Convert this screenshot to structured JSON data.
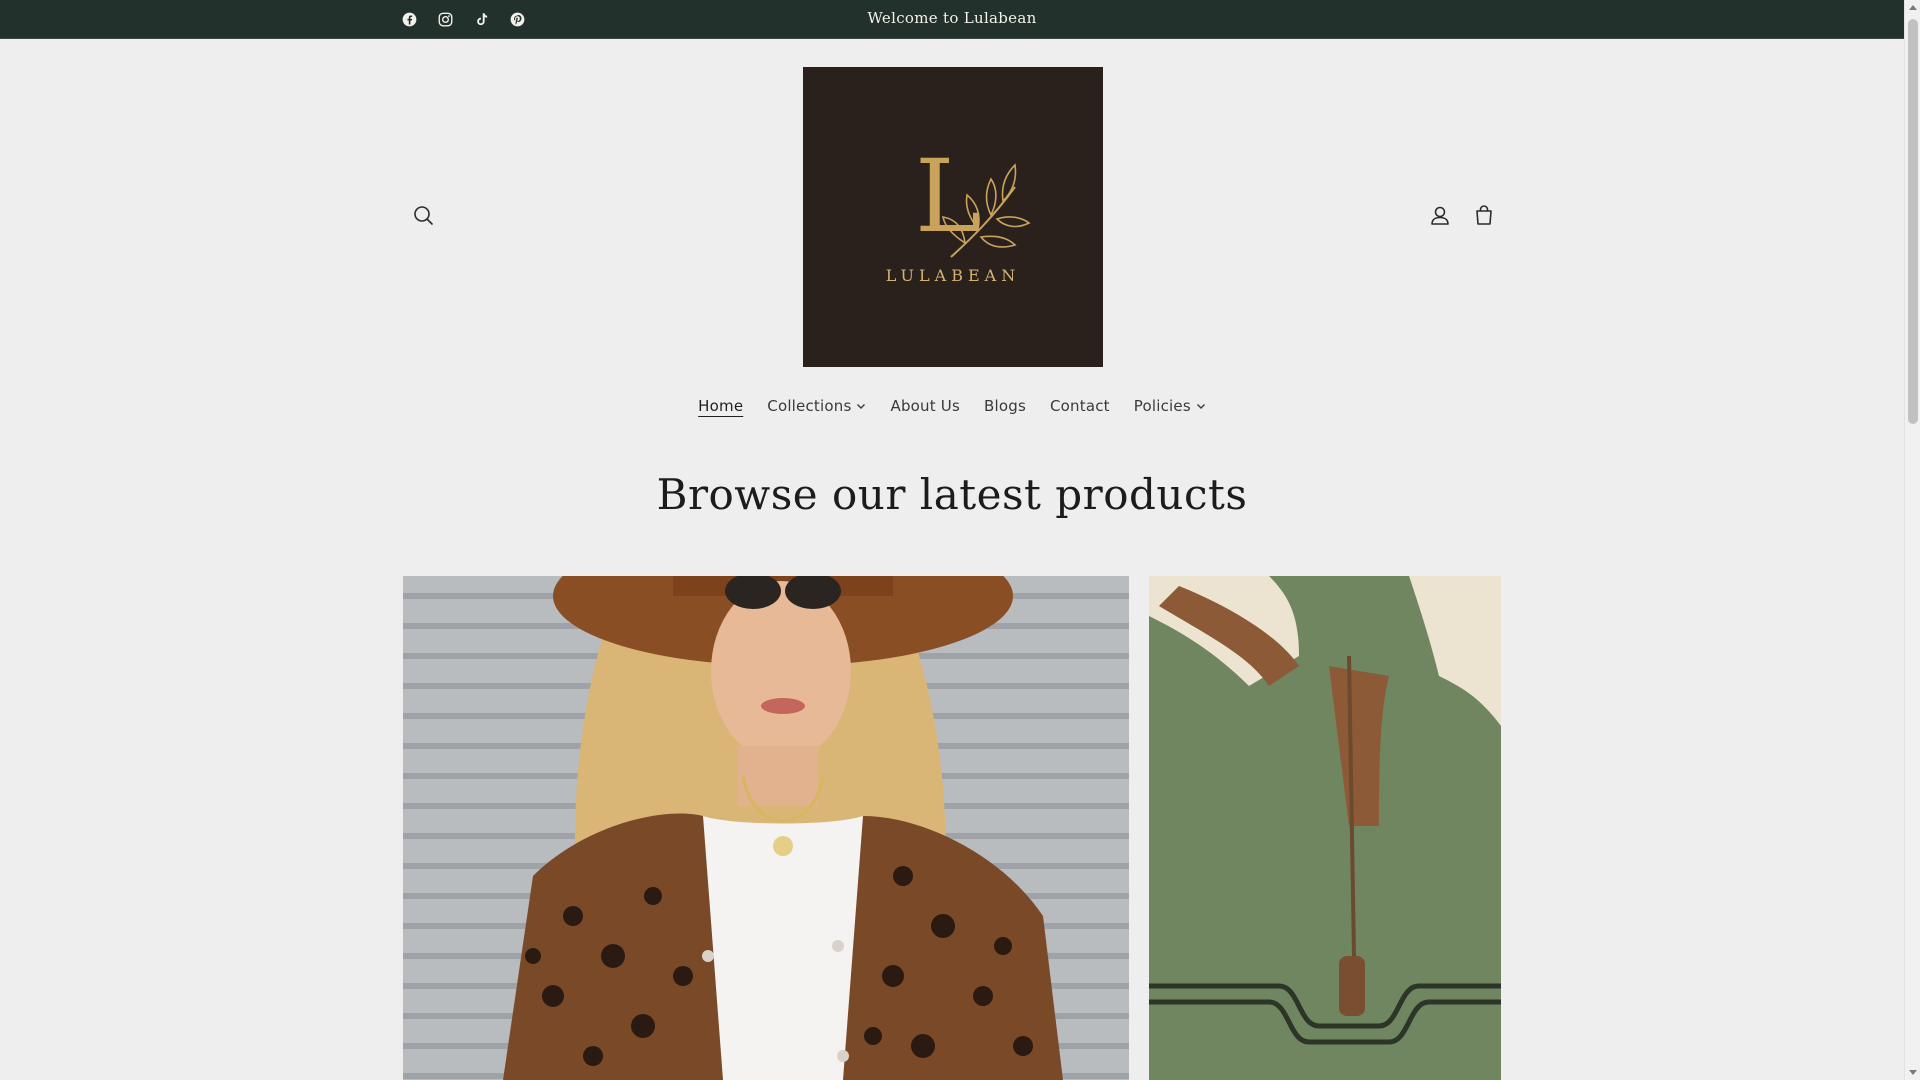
{
  "announcement": {
    "text": "Welcome to Lulabean",
    "social": [
      {
        "icon": "facebook-icon",
        "label": "Facebook"
      },
      {
        "icon": "instagram-icon",
        "label": "Instagram"
      },
      {
        "icon": "tiktok-icon",
        "label": "TikTok"
      },
      {
        "icon": "pinterest-icon",
        "label": "Pinterest"
      }
    ]
  },
  "header": {
    "logo": {
      "letter": "L",
      "wordmark": "LULABEAN"
    },
    "icons": {
      "search": "search-icon",
      "account": "account-icon",
      "cart": "cart-icon"
    }
  },
  "nav": {
    "items": [
      {
        "label": "Home",
        "active": true,
        "dropdown": false
      },
      {
        "label": "Collections",
        "active": false,
        "dropdown": true
      },
      {
        "label": "About Us",
        "active": false,
        "dropdown": false
      },
      {
        "label": "Blogs",
        "active": false,
        "dropdown": false
      },
      {
        "label": "Contact",
        "active": false,
        "dropdown": false
      },
      {
        "label": "Policies",
        "active": false,
        "dropdown": true
      }
    ]
  },
  "main": {
    "title": "Browse our latest products"
  },
  "colors": {
    "announcement_bg": "#22312b",
    "page_bg": "#efeeee",
    "logo_bg": "#2a211c",
    "logo_gold": "#c9a35c"
  }
}
